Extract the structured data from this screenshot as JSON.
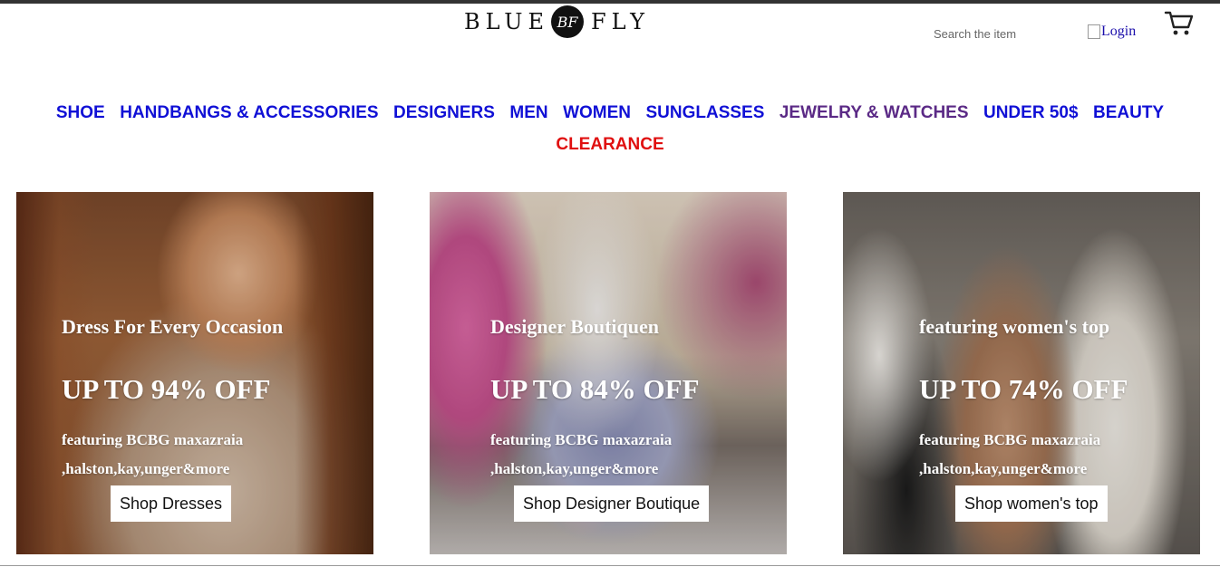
{
  "header": {
    "logo": {
      "left": "BLUE",
      "monogram": "BF",
      "right": "FLY"
    },
    "search": {
      "placeholder": "Search the item"
    },
    "login_label": "Login",
    "cart_icon": "cart-icon"
  },
  "nav": {
    "items": [
      {
        "label": "SHOE"
      },
      {
        "label": "HANDBANGS & ACCESSORIES"
      },
      {
        "label": "DESIGNERS"
      },
      {
        "label": "MEN"
      },
      {
        "label": "WOMEN"
      },
      {
        "label": "SUNGLASSES"
      },
      {
        "label": "JEWELRY & WATCHES"
      },
      {
        "label": "UNDER 50$"
      },
      {
        "label": "BEAUTY"
      },
      {
        "label": "CLEARANCE"
      }
    ],
    "colors": {
      "link": "#1010d6",
      "visited": "#5b2a86",
      "clearance": "#e01010"
    }
  },
  "promos": [
    {
      "heading": "Dress For Every Occasion",
      "discount": "UP TO 94% OFF",
      "featuring": "featuring BCBG maxazraia ,halston,kay,unger&more",
      "button": "Shop Dresses"
    },
    {
      "heading": "Designer Boutiquen",
      "discount": "UP TO 84% OFF",
      "featuring": "featuring BCBG maxazraia ,halston,kay,unger&more",
      "button": "Shop Designer Boutique"
    },
    {
      "heading": "featuring women's top",
      "discount": "UP TO 74% OFF",
      "featuring": "featuring BCBG maxazraia ,halston,kay,unger&more",
      "button": "Shop women's top"
    }
  ]
}
